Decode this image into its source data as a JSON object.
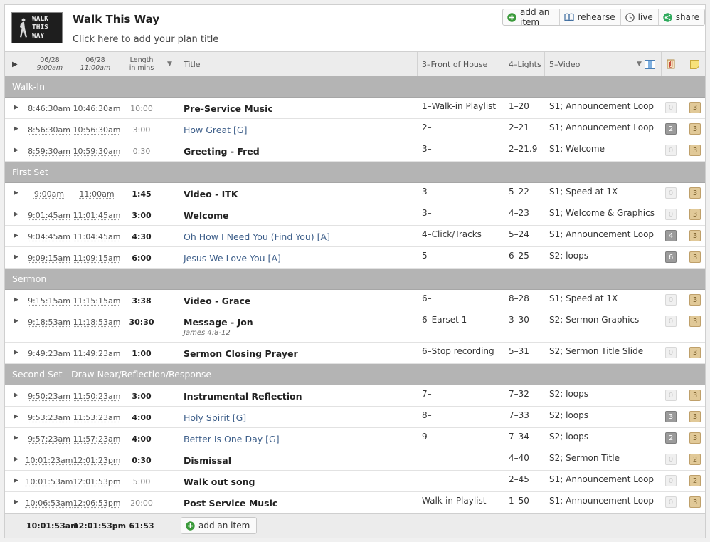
{
  "header": {
    "logo_text": [
      "WALK",
      "THIS",
      "WAY"
    ],
    "plan_name": "Walk This Way",
    "plan_title_placeholder": "Click here to add your plan title"
  },
  "toolbar": {
    "add_item": "add an item",
    "rehearse": "rehearse",
    "live": "live",
    "share": "share"
  },
  "columns": {
    "time1_date": "06/28",
    "time1_time": "9:00am",
    "time2_date": "06/28",
    "time2_time": "11:00am",
    "length_line1": "Length",
    "length_line2": "in mins",
    "title": "Title",
    "foh": "3–Front of House",
    "lights": "4–Lights",
    "video": "5–Video"
  },
  "colors": {
    "section_bg": "#b4b4b4",
    "song_link": "#3e5f8a",
    "note_badge": "#e1c998",
    "attach_badge": "#9b9b9b",
    "add_icon": "#3a9a3a",
    "share_icon": "#2eaa5c"
  },
  "sections": [
    {
      "name": "Walk-In",
      "items": [
        {
          "t1": "8:46:30am",
          "t2": "10:46:30am",
          "len": "10:00",
          "len_style": "dim",
          "title": "Pre-Service Music",
          "is_song": false,
          "foh": "1–Walk-in Playlist",
          "lights": "1–20",
          "video": "S1; Announcement Loop",
          "attach": "0",
          "notes": "3"
        },
        {
          "t1": "8:56:30am",
          "t2": "10:56:30am",
          "len": "3:00",
          "len_style": "dim",
          "title": "How Great [G]",
          "is_song": true,
          "foh": "2–",
          "lights": "2–21",
          "video": "S1; Announcement Loop",
          "attach": "2",
          "notes": "3"
        },
        {
          "t1": "8:59:30am",
          "t2": "10:59:30am",
          "len": "0:30",
          "len_style": "dim",
          "title": "Greeting - Fred",
          "is_song": false,
          "foh": "3–",
          "lights": "2–21.9",
          "video": "S1; Welcome",
          "attach": "0",
          "notes": "3"
        }
      ]
    },
    {
      "name": "First Set",
      "items": [
        {
          "t1": "9:00am",
          "t2": "11:00am",
          "len": "1:45",
          "len_style": "bold",
          "title": "Video - ITK",
          "is_song": false,
          "foh": "3–",
          "lights": "5–22",
          "video": "S1; Speed at 1X",
          "attach": "0",
          "notes": "3"
        },
        {
          "t1": "9:01:45am",
          "t2": "11:01:45am",
          "len": "3:00",
          "len_style": "bold",
          "title": "Welcome",
          "is_song": false,
          "foh": "3–",
          "lights": "4–23",
          "video": "S1; Welcome & Graphics",
          "attach": "0",
          "notes": "3"
        },
        {
          "t1": "9:04:45am",
          "t2": "11:04:45am",
          "len": "4:30",
          "len_style": "bold",
          "title": "Oh How I Need You (Find You) [A]",
          "is_song": true,
          "foh": "4–Click/Tracks",
          "lights": "5–24",
          "video": "S1; Announcement Loop",
          "attach": "4",
          "notes": "3"
        },
        {
          "t1": "9:09:15am",
          "t2": "11:09:15am",
          "len": "6:00",
          "len_style": "bold",
          "title": "Jesus We Love You [A]",
          "is_song": true,
          "foh": "5–",
          "lights": "6–25",
          "video": "S2; loops",
          "attach": "6",
          "notes": "3"
        }
      ]
    },
    {
      "name": "Sermon",
      "items": [
        {
          "t1": "9:15:15am",
          "t2": "11:15:15am",
          "len": "3:38",
          "len_style": "bold",
          "title": "Video - Grace",
          "is_song": false,
          "foh": "6–",
          "lights": "8–28",
          "video": "S1; Speed at 1X",
          "attach": "0",
          "notes": "3"
        },
        {
          "t1": "9:18:53am",
          "t2": "11:18:53am",
          "len": "30:30",
          "len_style": "bold",
          "title": "Message - Jon",
          "subtitle": "James 4:8-12",
          "is_song": false,
          "foh": "6–Earset 1",
          "lights": "3–30",
          "video": "S2; Sermon Graphics",
          "attach": "0",
          "notes": "3"
        },
        {
          "t1": "9:49:23am",
          "t2": "11:49:23am",
          "len": "1:00",
          "len_style": "bold",
          "title": "Sermon Closing Prayer",
          "is_song": false,
          "foh": "6–Stop recording",
          "lights": "5–31",
          "video": "S2; Sermon Title Slide",
          "attach": "0",
          "notes": "3"
        }
      ]
    },
    {
      "name": "Second Set - Draw Near/Reflection/Response",
      "items": [
        {
          "t1": "9:50:23am",
          "t2": "11:50:23am",
          "len": "3:00",
          "len_style": "bold",
          "title": "Instrumental Reflection",
          "is_song": false,
          "foh": "7–",
          "lights": "7–32",
          "video": "S2; loops",
          "attach": "0",
          "notes": "3"
        },
        {
          "t1": "9:53:23am",
          "t2": "11:53:23am",
          "len": "4:00",
          "len_style": "bold",
          "title": "Holy Spirit [G]",
          "is_song": true,
          "foh": "8–",
          "lights": "7–33",
          "video": "S2; loops",
          "attach": "3",
          "notes": "3"
        },
        {
          "t1": "9:57:23am",
          "t2": "11:57:23am",
          "len": "4:00",
          "len_style": "bold",
          "title": "Better Is One Day [G]",
          "is_song": true,
          "foh": "9–",
          "lights": "7–34",
          "video": "S2; loops",
          "attach": "2",
          "notes": "3"
        },
        {
          "t1": "10:01:23am",
          "t2": "12:01:23pm",
          "len": "0:30",
          "len_style": "bold",
          "title": "Dismissal",
          "is_song": false,
          "foh": "",
          "lights": "4–40",
          "video": "S2; Sermon Title",
          "attach": "0",
          "notes": "2"
        },
        {
          "t1": "10:01:53am",
          "t2": "12:01:53pm",
          "len": "5:00",
          "len_style": "dim",
          "title": "Walk out song",
          "is_song": false,
          "foh": "",
          "lights": "2–45",
          "video": "S1; Announcement Loop",
          "attach": "0",
          "notes": "2"
        },
        {
          "t1": "10:06:53am",
          "t2": "12:06:53pm",
          "len": "20:00",
          "len_style": "dim",
          "title": "Post Service Music",
          "is_song": false,
          "foh": "Walk-in Playlist",
          "lights": "1–50",
          "video": "S1; Announcement Loop",
          "attach": "0",
          "notes": "3"
        }
      ]
    }
  ],
  "footer": {
    "end_time1": "10:01:53am",
    "end_time2": "12:01:53pm",
    "total_length": "61:53",
    "add_item": "add an item"
  }
}
